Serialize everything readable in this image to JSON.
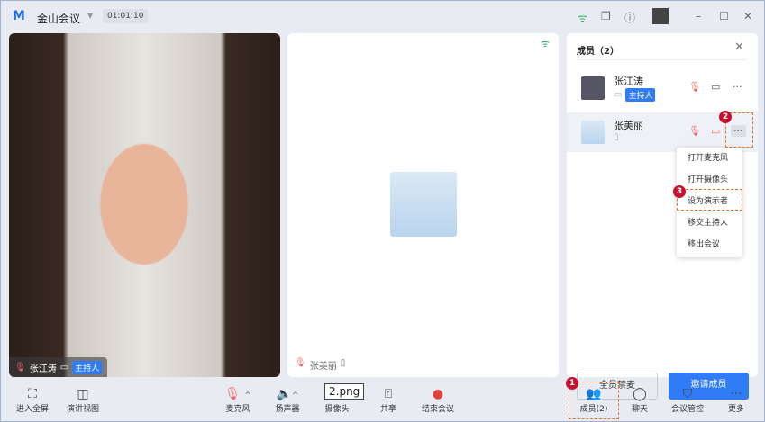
{
  "window": {
    "app_title": "金山会议",
    "timer": "01:01:10"
  },
  "tiles": {
    "left": {
      "name": "张江涛",
      "badge": "主持人"
    },
    "middle": {
      "name": "张美丽"
    }
  },
  "panel": {
    "title": "成员（2）",
    "members": [
      {
        "name": "张江涛",
        "badge": "主持人"
      },
      {
        "name": "张美丽"
      }
    ],
    "menu": [
      "打开麦克风",
      "打开摄像头",
      "设为演示者",
      "移交主持人",
      "移出会议"
    ],
    "mute_all": "全员禁麦",
    "invite": "邀请成员"
  },
  "annotations": [
    "1",
    "2",
    "3"
  ],
  "tooltip": "2.png",
  "toolbar": {
    "fullscreen": "进入全屏",
    "speaker_view": "演讲视图",
    "mic": "麦克风",
    "speaker": "扬声器",
    "camera": "摄像头",
    "share": "共享",
    "end": "结束会议",
    "members": "成员(2)",
    "chat": "聊天",
    "control": "会议管控",
    "more": "更多"
  },
  "colors": {
    "accent": "#2f7cf6",
    "end": "#e5403a",
    "annotation": "#c8102e",
    "wifi": "#2bb36a"
  }
}
